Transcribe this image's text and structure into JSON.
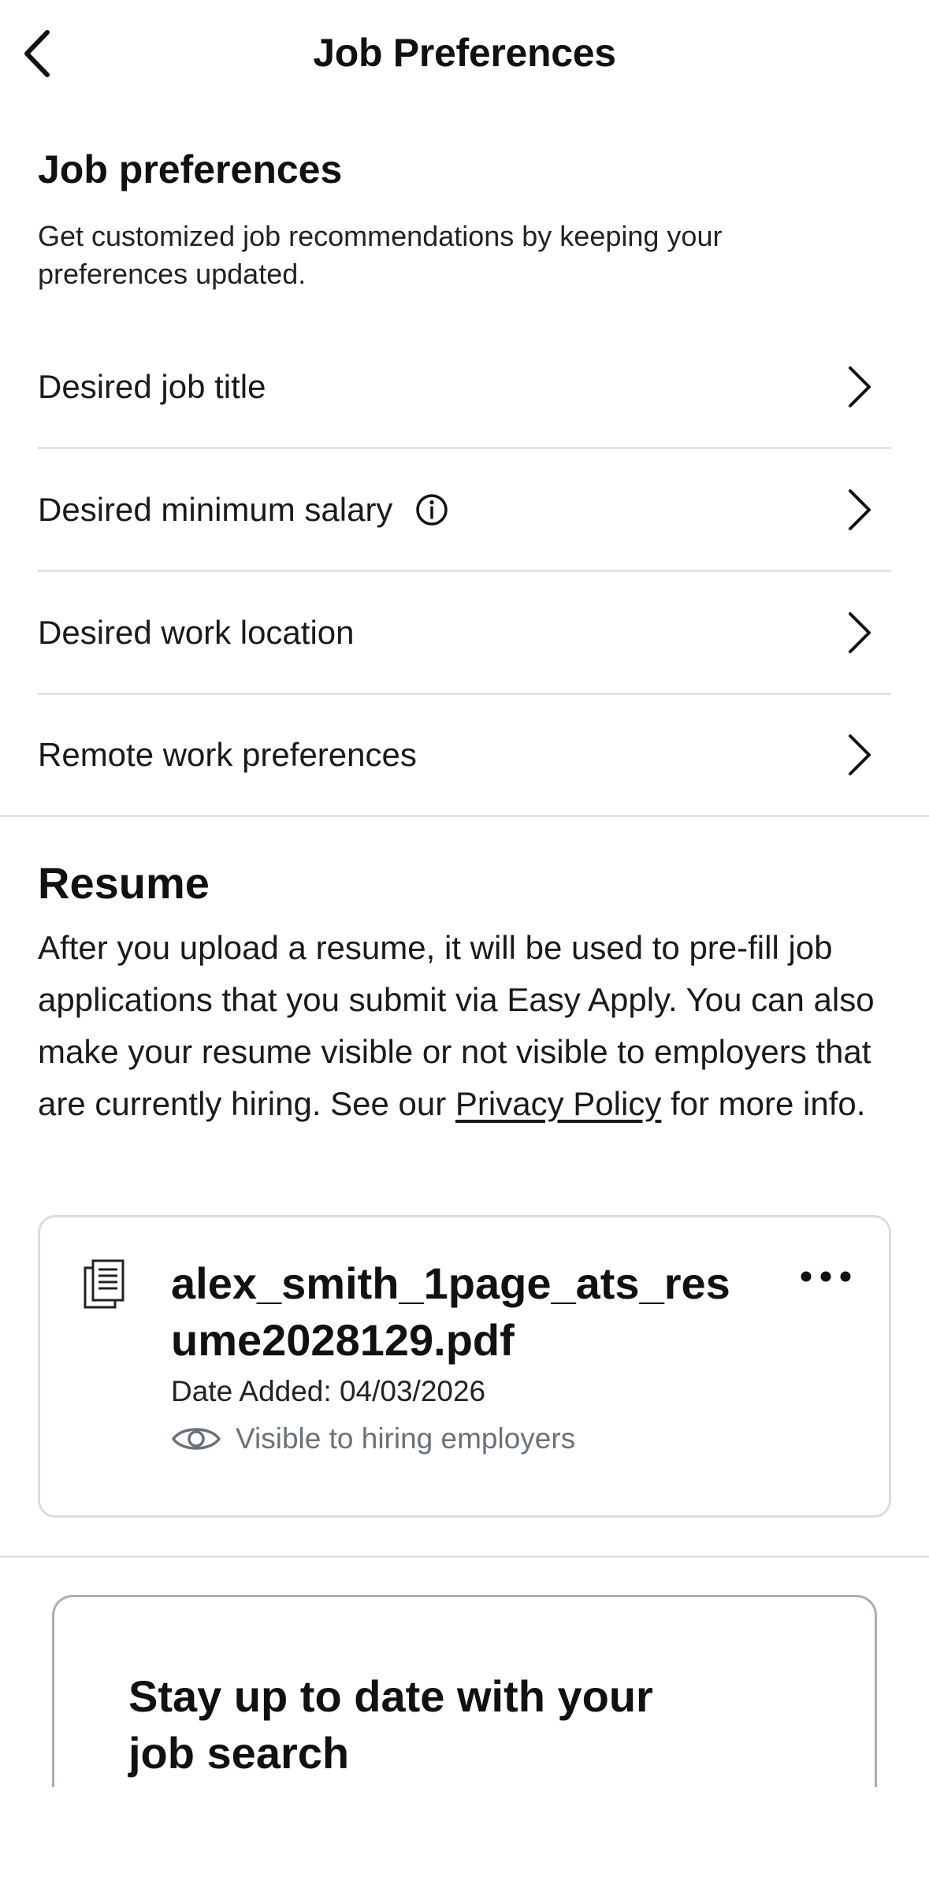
{
  "header": {
    "title": "Job Preferences",
    "back_icon": "chevron-left-icon"
  },
  "job_preferences": {
    "title": "Job preferences",
    "description": "Get customized job recommendations by keeping your preferences updated.",
    "items": [
      {
        "label": "Desired job title",
        "has_info": false
      },
      {
        "label": "Desired minimum salary",
        "has_info": true
      },
      {
        "label": "Desired work location",
        "has_info": false
      },
      {
        "label": "Remote work preferences",
        "has_info": false
      }
    ]
  },
  "resume": {
    "title": "Resume",
    "description_before": "After you upload a resume, it will be used to pre-fill job applications that you submit via Easy Apply. You can also make your resume visible or not visible to employers that are currently hiring. See our ",
    "link_text": "Privacy Policy",
    "description_after": " for more info.",
    "file": {
      "name": "alex_smith_1page_ats_resume2028129.pdf",
      "date_added": "Date Added: 04/03/2026",
      "visibility": "Visible to hiring employers",
      "icon": "document-icon"
    }
  },
  "promo": {
    "title": "Stay up to date with your job search"
  },
  "colors": {
    "text": "#111111",
    "muted": "#6a7179",
    "divider": "#e2e2e2",
    "card_border": "#dcdcdc"
  }
}
